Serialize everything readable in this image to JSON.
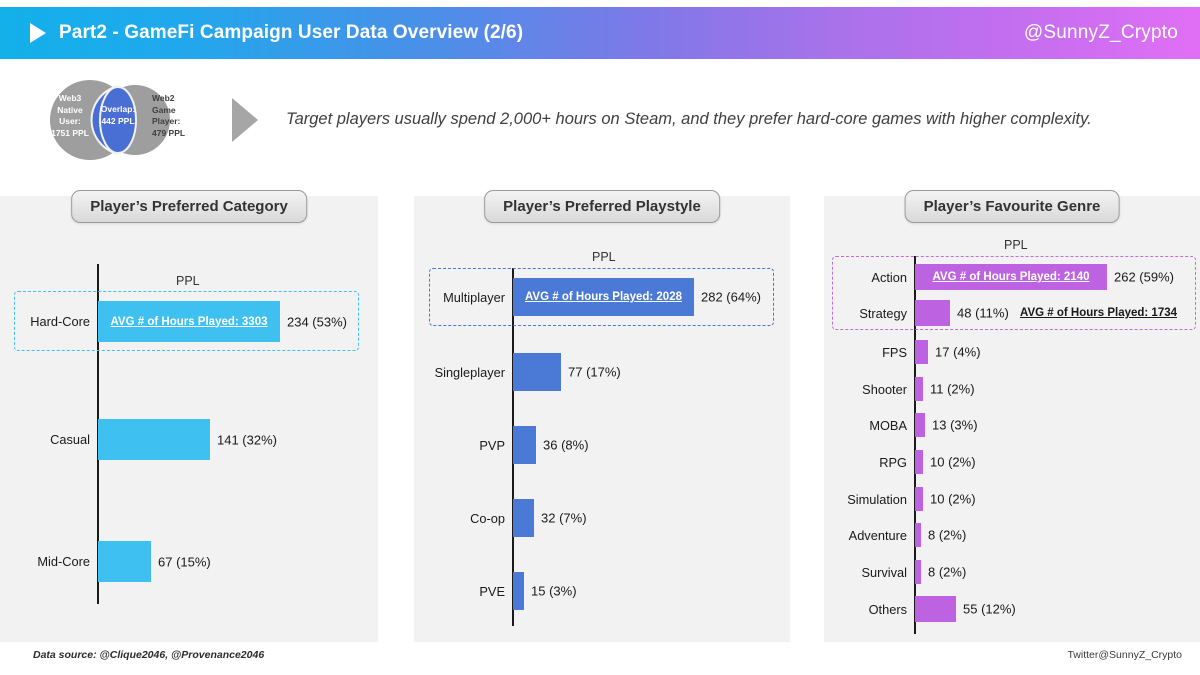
{
  "header": {
    "play_icon": "play-triangle-icon",
    "title": "Part2 - GameFi Campaign User Data Overview (2/6)",
    "handle": "@SunnyZ_Crypto"
  },
  "venn": {
    "left_label": "Web3\nNative\nUser:\n1751 PPL",
    "left_line1": "Web3",
    "left_line2": "Native",
    "left_line3": "User:",
    "left_line4": "1751 PPL",
    "overlap_line1": "Overlap:",
    "overlap_line2": "442 PPL",
    "right_line1": "Web2",
    "right_line2": "Game",
    "right_line3": "Player:",
    "right_line4": "479 PPL",
    "colors": {
      "circle_gray": "#9e9e9e",
      "overlap_blue": "#4a6fd4"
    }
  },
  "lede": "Target players usually spend 2,000+ hours on Steam, and they prefer hard-core games with higher complexity.",
  "footer": {
    "data_source": "Data source: @Clique2046, @Provenance2046",
    "twitter": "Twitter@SunnyZ_Crypto"
  },
  "chart_data": [
    {
      "type": "bar",
      "title": "Player’s Preferred  Category",
      "axis_label": "PPL",
      "orientation": "horizontal",
      "bar_color": "#3ec0f0",
      "highlight_color": "#3ec0f0",
      "categories": [
        "Hard-Core",
        "Casual",
        "Mid-Core"
      ],
      "values": [
        234,
        141,
        67
      ],
      "percent_labels": [
        "234 (53%)",
        "141 (32%)",
        "67 (15%)"
      ],
      "percents": [
        53,
        32,
        15
      ],
      "highlighted_index": 0,
      "annotations": [
        {
          "index": 0,
          "text": "AVG # of Hours Played: 3303",
          "avg_hours": 3303,
          "placement": "inside"
        }
      ]
    },
    {
      "type": "bar",
      "title": "Player’s Preferred  Playstyle",
      "axis_label": "PPL",
      "orientation": "horizontal",
      "bar_color": "#4a7ad6",
      "highlight_color": "#4a74d6",
      "categories": [
        "Multiplayer",
        "Singleplayer",
        "PVP",
        "Co-op",
        "PVE"
      ],
      "values": [
        282,
        77,
        36,
        32,
        15
      ],
      "percent_labels": [
        "282 (64%)",
        "77 (17%)",
        "36 (8%)",
        "32 (7%)",
        "15 (3%)"
      ],
      "percents": [
        64,
        17,
        8,
        7,
        3
      ],
      "highlighted_index": 0,
      "annotations": [
        {
          "index": 0,
          "text": "AVG # of Hours Played: 2028",
          "avg_hours": 2028,
          "placement": "inside"
        }
      ]
    },
    {
      "type": "bar",
      "title": "Player’s Favourite  Genre",
      "axis_label": "PPL",
      "orientation": "horizontal",
      "bar_color": "#bd62e0",
      "highlight_color": "#c06ddc",
      "categories": [
        "Action",
        "Strategy",
        "FPS",
        "Shooter",
        "MOBA",
        "RPG",
        "Simulation",
        "Adventure",
        "Survival",
        "Others"
      ],
      "values": [
        262,
        48,
        17,
        11,
        13,
        10,
        10,
        8,
        8,
        55
      ],
      "percent_labels": [
        "262 (59%)",
        "48 (11%)",
        "17 (4%)",
        "11 (2%)",
        "13 (3%)",
        "10 (2%)",
        "10 (2%)",
        "8 (2%)",
        "8 (2%)",
        "55 (12%)"
      ],
      "percents": [
        59,
        11,
        4,
        2,
        3,
        2,
        2,
        2,
        2,
        12
      ],
      "highlighted_index": 0,
      "highlighted_indices": [
        0,
        1
      ],
      "annotations": [
        {
          "index": 0,
          "text": "AVG # of Hours Played: 2140",
          "avg_hours": 2140,
          "placement": "inside"
        },
        {
          "index": 1,
          "text": "AVG # of Hours Played: 1734",
          "avg_hours": 1734,
          "placement": "right"
        }
      ]
    }
  ]
}
